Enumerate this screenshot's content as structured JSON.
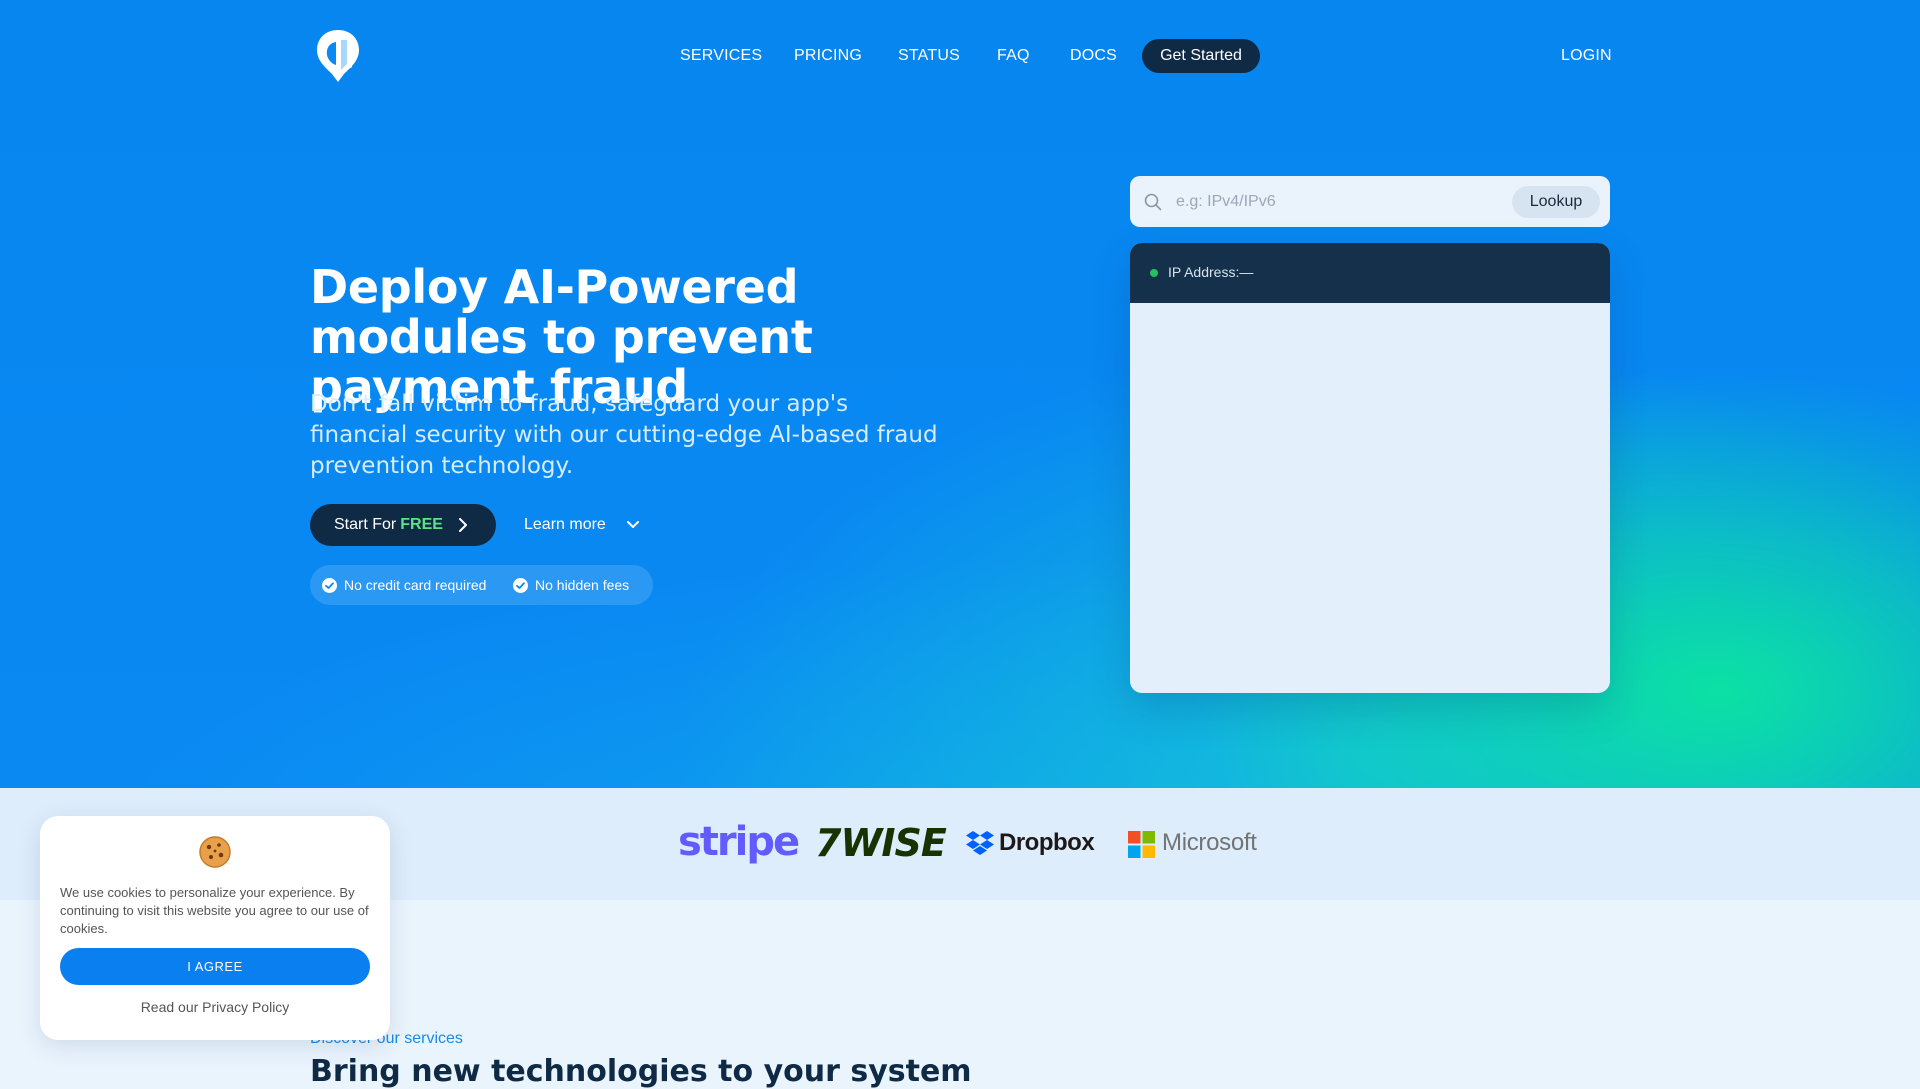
{
  "nav": {
    "items": [
      {
        "label": "SERVICES"
      },
      {
        "label": "PRICING"
      },
      {
        "label": "STATUS"
      },
      {
        "label": "FAQ"
      },
      {
        "label": "DOCS"
      }
    ],
    "cta_label": "Get Started",
    "login_label": "LOGIN"
  },
  "hero": {
    "title": "Deploy AI-Powered modules to prevent payment fraud",
    "subtitle": "Don't fall victim to fraud, safeguard your app's financial security with our cutting-edge AI-based fraud prevention technology.",
    "start_label": "Start For",
    "start_highlight": "FREE",
    "learn_more_label": "Learn more",
    "badges": [
      "No credit card required",
      "No hidden fees"
    ]
  },
  "lookup": {
    "placeholder": "e.g: IPv4/IPv6",
    "button_label": "Lookup",
    "ip_label": "IP Address:—"
  },
  "partners": {
    "stripe": "stripe",
    "wise": "7WISE",
    "dropbox": "Dropbox",
    "microsoft": "Microsoft"
  },
  "services": {
    "eyebrow": "Discover our services",
    "title": "Bring new technologies to your system"
  },
  "cookie": {
    "text": "We use cookies to personalize your experience. By continuing to visit this website you agree to our use of cookies.",
    "agree_label": "I AGREE",
    "privacy_label": "Read our Privacy Policy"
  },
  "colors": {
    "hero_blue": "#0a89f3",
    "hero_green": "#0ce4a0",
    "dark_navy": "#0f2a44",
    "free_green": "#5fe08a",
    "status_green": "#22c35a",
    "stripe": "#635bff",
    "wise": "#163300"
  }
}
